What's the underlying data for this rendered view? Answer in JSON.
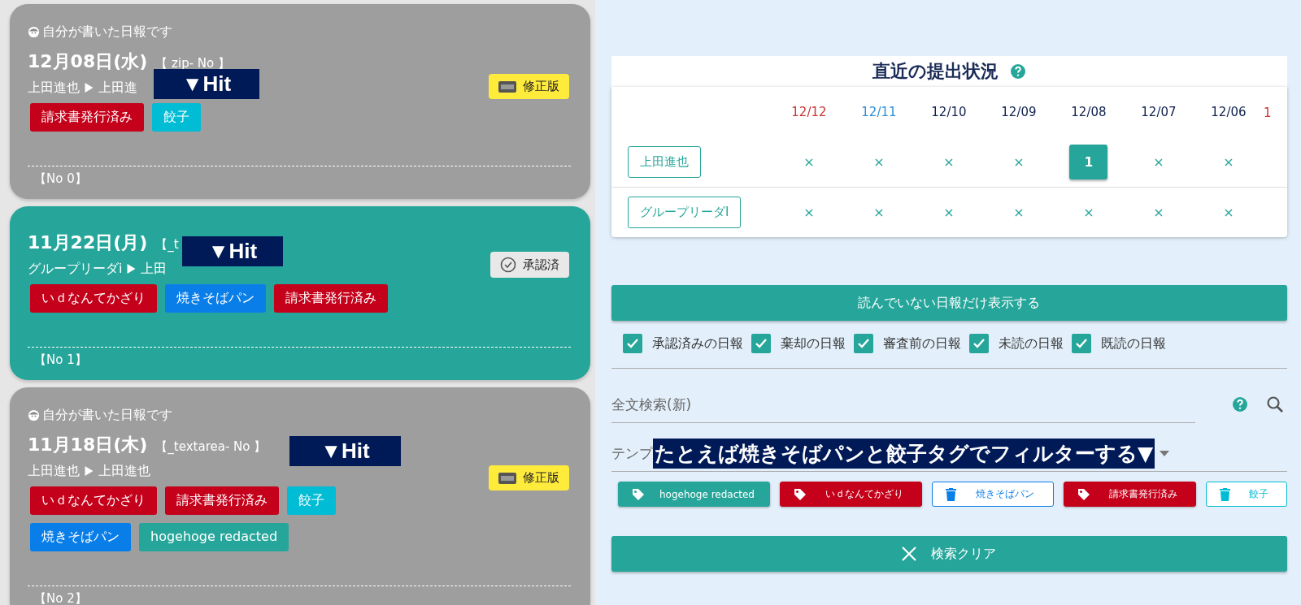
{
  "reports": [
    {
      "kind": "pending",
      "note": "自分が書いた日報です",
      "date": "12月08日(水)",
      "title_tag": "【 zip- No 】",
      "sender": "上田進也",
      "receiver": "上田進",
      "badge": {
        "kind": "revised",
        "label": "修正版"
      },
      "hit": {
        "label": "▼Hit"
      },
      "tags": [
        {
          "label": "請求書発行済み",
          "color": "#c4001a"
        },
        {
          "label": "餃子",
          "color": "#00bcd4"
        }
      ],
      "number": "【No 0】"
    },
    {
      "kind": "approved",
      "date": "11月22日(月)",
      "title_tag": "【_t",
      "sender": "グループリーダi",
      "receiver": "上田",
      "badge": {
        "kind": "approved",
        "label": "承認済"
      },
      "hit": {
        "label": "▼Hit"
      },
      "tags": [
        {
          "label": "いｄなんてかざり",
          "color": "#c4001a"
        },
        {
          "label": "焼きそばパン",
          "color": "#0a7ee8"
        },
        {
          "label": "請求書発行済み",
          "color": "#c4001a"
        }
      ],
      "number": "【No 1】"
    },
    {
      "kind": "pending",
      "note": "自分が書いた日報です",
      "date": "11月18日(木)",
      "title_tag": "【_textarea- No 】",
      "sender": "上田進也",
      "receiver": "上田進也",
      "badge": {
        "kind": "revised",
        "label": "修正版"
      },
      "hit": {
        "label": "▼Hit"
      },
      "tags": [
        {
          "label": "いｄなんてかざり",
          "color": "#c4001a"
        },
        {
          "label": "請求書発行済み",
          "color": "#c4001a"
        },
        {
          "label": "餃子",
          "color": "#00bcd4"
        },
        {
          "label": "焼きそばパン",
          "color": "#0a7ee8"
        },
        {
          "label": "hogehoge redacted",
          "color": "#26a69a"
        }
      ],
      "number": "【No 2】"
    }
  ],
  "status": {
    "title": "直近の提出状況",
    "dates": [
      {
        "label": "12/12",
        "kind": "sunday"
      },
      {
        "label": "12/11",
        "kind": "saturday"
      },
      {
        "label": "12/10",
        "kind": "weekday"
      },
      {
        "label": "12/09",
        "kind": "weekday"
      },
      {
        "label": "12/08",
        "kind": "weekday"
      },
      {
        "label": "12/07",
        "kind": "weekday"
      },
      {
        "label": "12/06",
        "kind": "weekday"
      },
      {
        "label": "1",
        "kind": "sunday"
      }
    ],
    "rows": [
      {
        "name": "上田進也",
        "cells": [
          {
            "kind": "none",
            "text": "×"
          },
          {
            "kind": "none",
            "text": "×"
          },
          {
            "kind": "none",
            "text": "×"
          },
          {
            "kind": "none",
            "text": "×"
          },
          {
            "kind": "count",
            "text": "1"
          },
          {
            "kind": "none",
            "text": "×"
          },
          {
            "kind": "none",
            "text": "×"
          }
        ]
      },
      {
        "name": "グループリーダI",
        "cells": [
          {
            "kind": "none",
            "text": "×"
          },
          {
            "kind": "none",
            "text": "×"
          },
          {
            "kind": "none",
            "text": "×"
          },
          {
            "kind": "none",
            "text": "×"
          },
          {
            "kind": "none",
            "text": "×"
          },
          {
            "kind": "none",
            "text": "×"
          },
          {
            "kind": "none",
            "text": "×"
          }
        ]
      }
    ]
  },
  "unread_button": "読んでいない日報だけ表示する",
  "filters": [
    {
      "label": "承認済みの日報",
      "checked": true
    },
    {
      "label": "棄却の日報",
      "checked": true
    },
    {
      "label": "審査前の日報",
      "checked": true
    },
    {
      "label": "未読の日報",
      "checked": true
    },
    {
      "label": "既読の日報",
      "checked": true
    }
  ],
  "search": {
    "placeholder": "全文検索(新)"
  },
  "template": {
    "label": "テンプ",
    "annotation": "たとえば焼きそばパンと餃子タグでフィルターする▼"
  },
  "tag_filters": [
    {
      "label": "hogehoge redacted",
      "kind": "include",
      "color": "#26a69a"
    },
    {
      "label": "いｄなんてかざり",
      "kind": "include",
      "color": "#c4001a"
    },
    {
      "label": "焼きそばパン",
      "kind": "exclude",
      "color": "#0a7ee8"
    },
    {
      "label": "請求書発行済み",
      "kind": "include",
      "color": "#c4001a"
    },
    {
      "label": "餃子",
      "kind": "exclude",
      "color": "#00bcd4"
    }
  ],
  "clear_button": "検索クリア"
}
